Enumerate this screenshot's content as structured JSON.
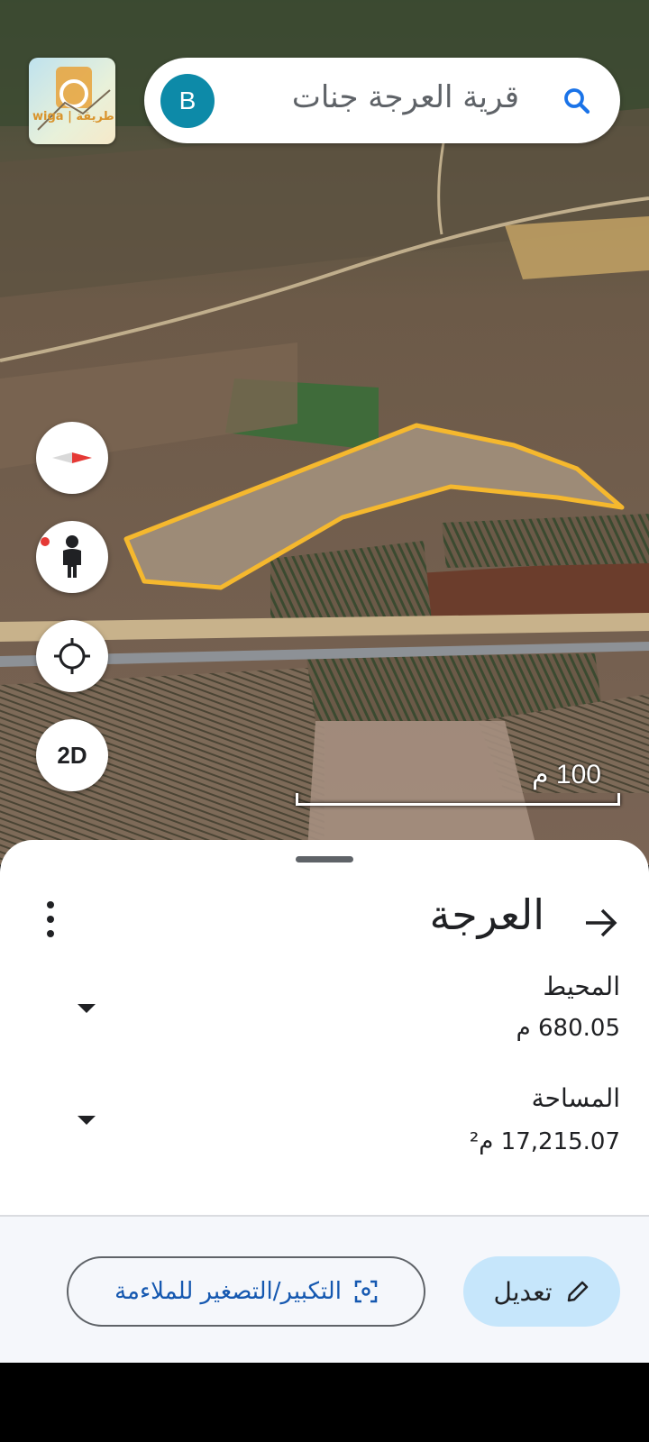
{
  "search": {
    "query": "قرية العرجة جنات",
    "avatar_letter": "B"
  },
  "logo": {
    "text": "wiga | طريقة"
  },
  "map": {
    "compass_icon": "compass-needle-icon",
    "streetview_icon": "pegman-icon",
    "location_icon": "my-location-icon",
    "view_mode_label": "2D",
    "scale_label": "100 م",
    "polygon_color": "#f5b82e"
  },
  "sheet": {
    "title": "العرجة",
    "perimeter_label": "المحيط",
    "perimeter_value": "680.05 م",
    "area_label": "المساحة",
    "area_value": "17,215.07 م²",
    "fit_button_label": "التكبير/التصغير للملاءمة",
    "edit_button_label": "تعديل"
  },
  "colors": {
    "accent_blue": "#1558b0",
    "edit_bg": "#c6e6fb",
    "avatar_bg": "#0d8aa8"
  }
}
